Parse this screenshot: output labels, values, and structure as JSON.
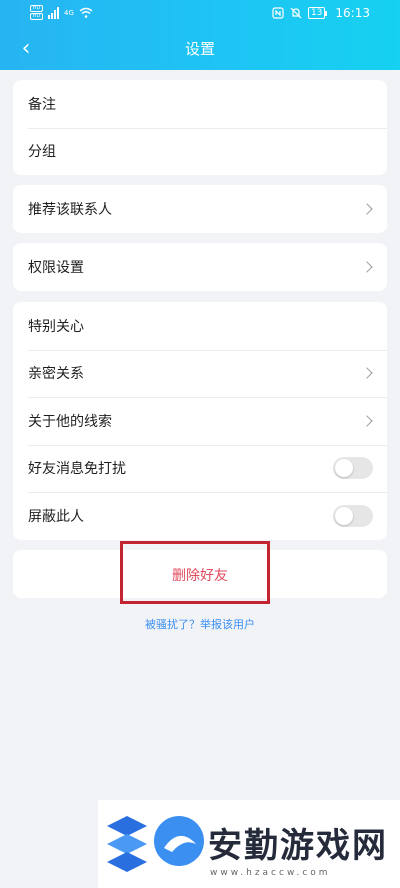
{
  "status_bar": {
    "hd_labels": [
      "HD",
      "HD"
    ],
    "network": "4G",
    "battery": "13",
    "time": "16:13"
  },
  "nav": {
    "title": "设置"
  },
  "card1": [
    {
      "label": "备注"
    },
    {
      "label": "分组"
    }
  ],
  "card2": [
    {
      "label": "推荐该联系人"
    }
  ],
  "card3": [
    {
      "label": "权限设置"
    }
  ],
  "card4": [
    {
      "label": "特别关心"
    },
    {
      "label": "亲密关系"
    },
    {
      "label": "关于他的线索"
    },
    {
      "label": "好友消息免打扰",
      "toggle": false
    },
    {
      "label": "屏蔽此人",
      "toggle": false
    }
  ],
  "delete_label": "删除好友",
  "report_link": "被骚扰了？举报该用户",
  "watermark": {
    "text": "安勤游戏网",
    "url": "www.hzaccw.com"
  },
  "colors": {
    "header_start": "#27b4f2",
    "header_end": "#16d1f0",
    "delete": "#e24a5e",
    "link": "#3a8ff0",
    "highlight_box": "#c4242f"
  }
}
